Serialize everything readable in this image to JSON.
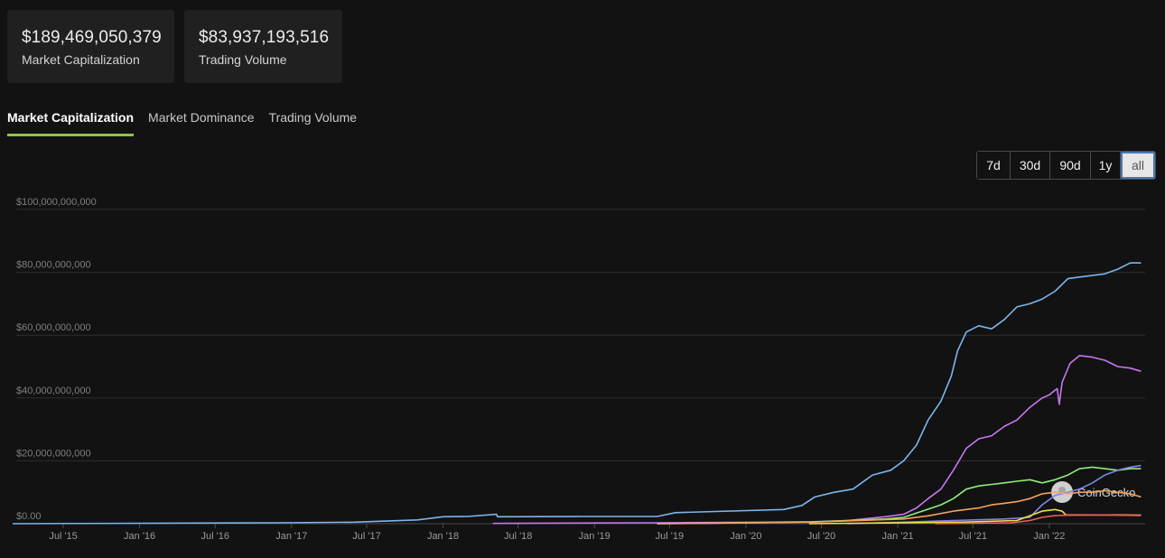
{
  "stats": [
    {
      "value": "$189,469,050,379",
      "label": "Market Capitalization"
    },
    {
      "value": "$83,937,193,516",
      "label": "Trading Volume"
    }
  ],
  "tabs": [
    "Market Capitalization",
    "Market Dominance",
    "Trading Volume"
  ],
  "active_tab": 0,
  "ranges": [
    "7d",
    "30d",
    "90d",
    "1y",
    "all"
  ],
  "active_range": 4,
  "watermark": "CoinGecko",
  "colors": {
    "accent": "#8dc647",
    "series": [
      "#7cb5ec",
      "#c876f0",
      "#90ed7d",
      "#8085e9",
      "#f7a35c",
      "#f0e040",
      "#f45b5b"
    ]
  },
  "chart_data": {
    "type": "line",
    "y_ticks": [
      "$0.00",
      "$20,000,000,000",
      "$40,000,000,000",
      "$60,000,000,000",
      "$80,000,000,000",
      "$100,000,000,000"
    ],
    "ylim": [
      0,
      100000000000
    ],
    "x_ticks": [
      "Jul '15",
      "Jan '16",
      "Jul '16",
      "Jan '17",
      "Jul '17",
      "Jan '18",
      "Jul '18",
      "Jan '19",
      "Jul '19",
      "Jan '20",
      "Jul '20",
      "Jan '21",
      "Jul '21",
      "Jan '22"
    ],
    "xlim": [
      "2015-03-01",
      "2022-08-20"
    ],
    "grid": true,
    "series": [
      {
        "color": "#7cb5ec",
        "x": [
          "2015-03-01",
          "2016-12-01",
          "2017-06-01",
          "2017-11-01",
          "2018-01-01",
          "2018-03-01",
          "2018-05-10",
          "2018-05-12",
          "2018-12-01",
          "2019-06-01",
          "2019-07-15",
          "2020-04-01",
          "2020-05-15",
          "2020-06-15",
          "2020-08-01",
          "2020-09-15",
          "2020-11-01",
          "2020-12-15",
          "2021-01-15",
          "2021-02-15",
          "2021-03-15",
          "2021-04-15",
          "2021-05-10",
          "2021-05-25",
          "2021-06-15",
          "2021-07-15",
          "2021-08-15",
          "2021-09-15",
          "2021-10-15",
          "2021-11-15",
          "2021-12-15",
          "2022-01-15",
          "2022-02-15",
          "2022-03-15",
          "2022-04-15",
          "2022-05-15",
          "2022-06-15",
          "2022-07-15",
          "2022-08-10"
        ],
        "y": [
          0,
          300000000.0,
          500000000.0,
          1200000000.0,
          2200000000.0,
          2300000000.0,
          3000000000.0,
          2200000000.0,
          2300000000.0,
          2300000000.0,
          3500000000.0,
          4500000000.0,
          5800000000.0,
          8500000000.0,
          10000000000.0,
          11000000000.0,
          15500000000.0,
          17000000000.0,
          20000000000.0,
          25000000000.0,
          33000000000.0,
          39000000000.0,
          47000000000.0,
          55000000000.0,
          61000000000.0,
          63000000000.0,
          62000000000.0,
          65000000000.0,
          69000000000.0,
          70000000000.0,
          71500000000.0,
          74000000000.0,
          78000000000.0,
          78500000000.0,
          79000000000.0,
          79500000000.0,
          81000000000.0,
          83000000000.0,
          83000000000.0
        ]
      },
      {
        "color": "#c876f0",
        "x": [
          "2018-05-01",
          "2019-06-01",
          "2020-03-01",
          "2020-06-01",
          "2020-09-01",
          "2020-12-01",
          "2021-01-15",
          "2021-02-15",
          "2021-03-15",
          "2021-04-15",
          "2021-05-15",
          "2021-06-15",
          "2021-07-15",
          "2021-08-15",
          "2021-09-15",
          "2021-10-15",
          "2021-11-15",
          "2021-12-15",
          "2022-01-01",
          "2022-01-20",
          "2022-01-25",
          "2022-02-01",
          "2022-02-20",
          "2022-03-15",
          "2022-04-15",
          "2022-05-15",
          "2022-06-15",
          "2022-07-15",
          "2022-08-10"
        ],
        "y": [
          100000000.0,
          300000000.0,
          500000000.0,
          600000000.0,
          1000000000.0,
          2200000000.0,
          3000000000.0,
          5000000000.0,
          8000000000.0,
          11000000000.0,
          17000000000.0,
          24000000000.0,
          27000000000.0,
          28000000000.0,
          31000000000.0,
          33000000000.0,
          37000000000.0,
          40000000000.0,
          41000000000.0,
          43000000000.0,
          38000000000.0,
          45000000000.0,
          51000000000.0,
          53500000000.0,
          53000000000.0,
          52000000000.0,
          50000000000.0,
          49500000000.0,
          48500000000.0
        ]
      },
      {
        "color": "#90ed7d",
        "x": [
          "2019-06-01",
          "2020-06-01",
          "2020-12-01",
          "2021-01-15",
          "2021-03-01",
          "2021-04-15",
          "2021-05-15",
          "2021-06-15",
          "2021-07-15",
          "2021-08-15",
          "2021-09-15",
          "2021-10-15",
          "2021-11-15",
          "2021-12-15",
          "2022-01-15",
          "2022-02-15",
          "2022-03-15",
          "2022-04-15",
          "2022-05-15",
          "2022-06-15",
          "2022-07-15",
          "2022-08-10"
        ],
        "y": [
          0,
          500000000.0,
          1500000000.0,
          2000000000.0,
          4000000000.0,
          6000000000.0,
          8000000000.0,
          11000000000.0,
          12000000000.0,
          12500000000.0,
          13000000000.0,
          13500000000.0,
          14000000000.0,
          13000000000.0,
          14000000000.0,
          15500000000.0,
          17500000000.0,
          18000000000.0,
          17500000000.0,
          17000000000.0,
          17500000000.0,
          17500000000.0
        ]
      },
      {
        "color": "#8085e9",
        "x": [
          "2020-09-01",
          "2021-01-15",
          "2021-05-15",
          "2021-09-15",
          "2021-11-15",
          "2021-12-15",
          "2022-01-15",
          "2022-02-15",
          "2022-03-15",
          "2022-04-15",
          "2022-05-15",
          "2022-06-15",
          "2022-07-15",
          "2022-08-10"
        ],
        "y": [
          0,
          500000000.0,
          1000000000.0,
          1500000000.0,
          2000000000.0,
          6000000000.0,
          9000000000.0,
          10000000000.0,
          11000000000.0,
          13000000000.0,
          15500000000.0,
          17000000000.0,
          18000000000.0,
          18500000000.0
        ]
      },
      {
        "color": "#f7a35c",
        "x": [
          "2019-06-01",
          "2020-06-01",
          "2021-01-15",
          "2021-03-15",
          "2021-05-15",
          "2021-07-15",
          "2021-08-15",
          "2021-09-15",
          "2021-10-15",
          "2021-11-15",
          "2021-12-15",
          "2022-01-15",
          "2022-02-15",
          "2022-03-15",
          "2022-04-15",
          "2022-05-15",
          "2022-06-15",
          "2022-07-15",
          "2022-08-10"
        ],
        "y": [
          0,
          500000000.0,
          1500000000.0,
          2500000000.0,
          4000000000.0,
          5000000000.0,
          6000000000.0,
          6500000000.0,
          7000000000.0,
          8000000000.0,
          9500000000.0,
          10000000000.0,
          9500000000.0,
          10000000000.0,
          10000000000.0,
          10500000000.0,
          10000000000.0,
          9500000000.0,
          8500000000.0
        ]
      },
      {
        "color": "#f0e040",
        "x": [
          "2020-06-01",
          "2021-06-01",
          "2021-10-15",
          "2021-11-15",
          "2021-12-15",
          "2022-01-15",
          "2022-02-01",
          "2022-02-10",
          "2022-04-15",
          "2022-06-15",
          "2022-08-10"
        ],
        "y": [
          0,
          500000000.0,
          1000000000.0,
          2500000000.0,
          4000000000.0,
          4500000000.0,
          4000000000.0,
          2800000000.0,
          2800000000.0,
          2800000000.0,
          2700000000.0
        ]
      },
      {
        "color": "#f45b5b",
        "x": [
          "2021-04-01",
          "2021-10-01",
          "2021-11-15",
          "2021-12-15",
          "2022-01-10",
          "2022-01-20",
          "2022-02-15",
          "2022-05-15",
          "2022-08-10"
        ],
        "y": [
          0,
          300000000.0,
          1000000000.0,
          2000000000.0,
          2500000000.0,
          2600000000.0,
          2700000000.0,
          2800000000.0,
          2600000000.0
        ]
      }
    ]
  }
}
